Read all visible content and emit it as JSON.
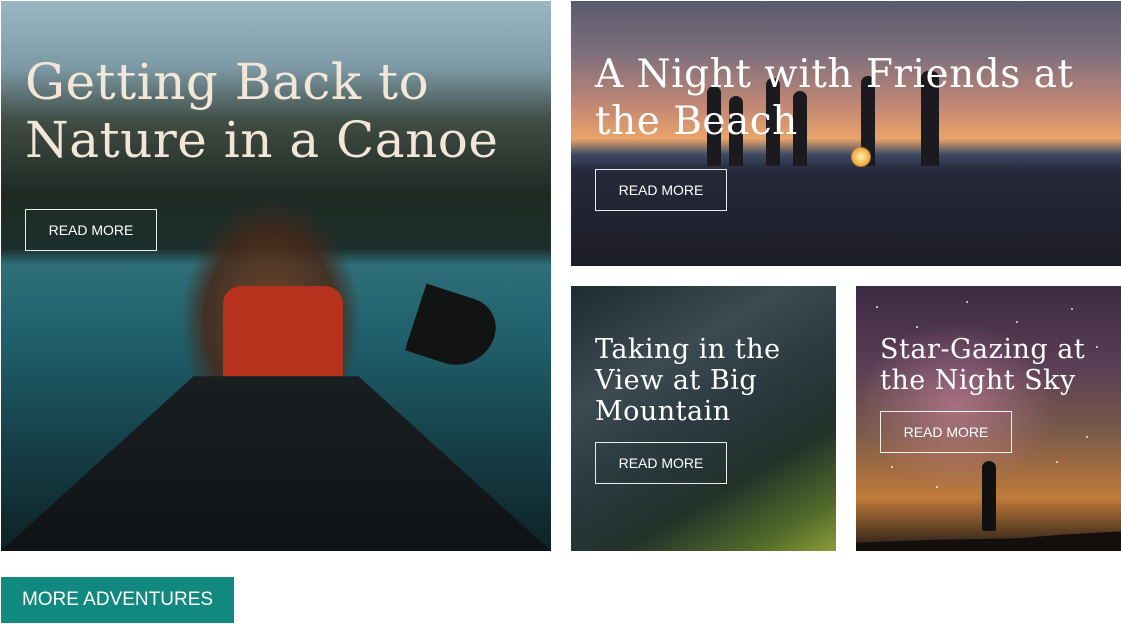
{
  "cards": [
    {
      "title": "Getting Back to Nature in a Canoe",
      "button": "READ MORE"
    },
    {
      "title": "A Night with Friends at the Beach",
      "button": "READ MORE"
    },
    {
      "title": "Taking in the View at Big Mountain",
      "button": "READ MORE"
    },
    {
      "title": "Star-Gazing at the Night Sky",
      "button": "READ MORE"
    }
  ],
  "more_button": "MORE ADVENTURES",
  "colors": {
    "accent": "#11897e",
    "title_cream": "#f2e6d6"
  }
}
